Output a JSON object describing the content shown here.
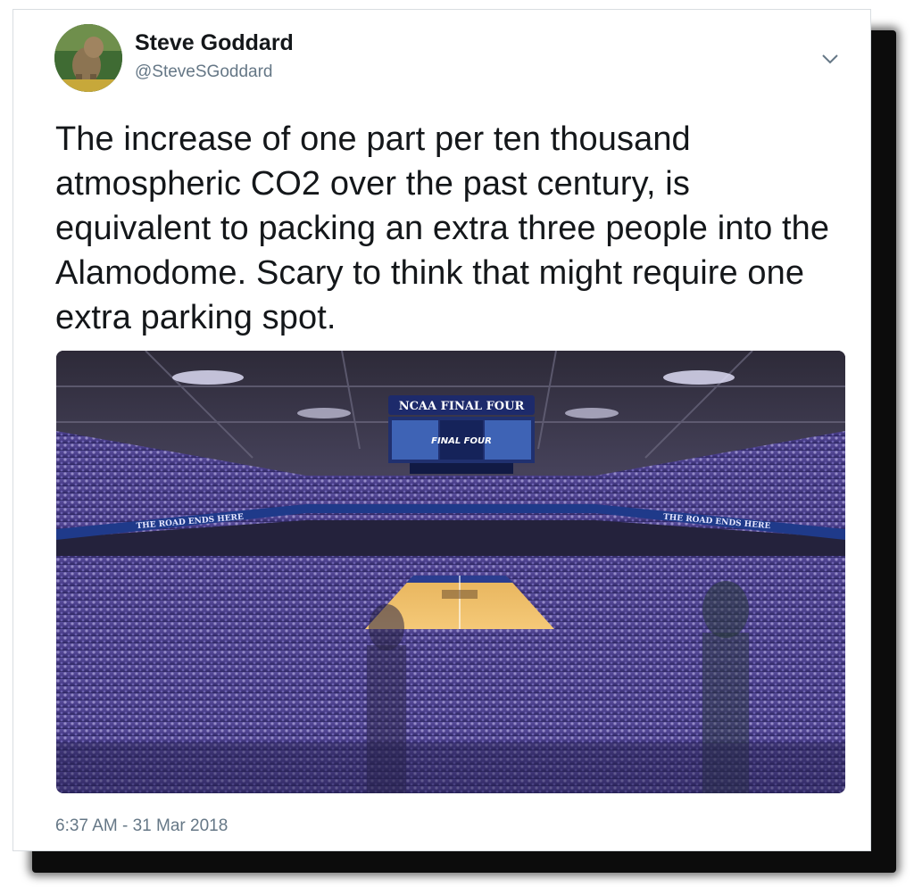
{
  "tweet": {
    "author": {
      "name": "Steve Goddard",
      "handle": "@SteveSGoddard",
      "avatar_icon": "avatar-photo"
    },
    "menu_icon": "chevron-down-icon",
    "text": "The increase of one part per ten thousand atmospheric CO2 over the past century, is equivalent to packing an extra three people into the Alamodome. Scary to think that might require one extra parking spot.",
    "media": {
      "scoreboard_title": "NCAA FINAL FOUR",
      "screen_logo": "FINAL FOUR",
      "banner_text": "THE ROAD ENDS HERE"
    },
    "timestamp": "6:37 AM - 31 Mar 2018"
  },
  "colors": {
    "text_primary": "#14171a",
    "text_secondary": "#657786",
    "card_border": "#d9dde1",
    "crowd_purple": "#4b3f8c"
  }
}
